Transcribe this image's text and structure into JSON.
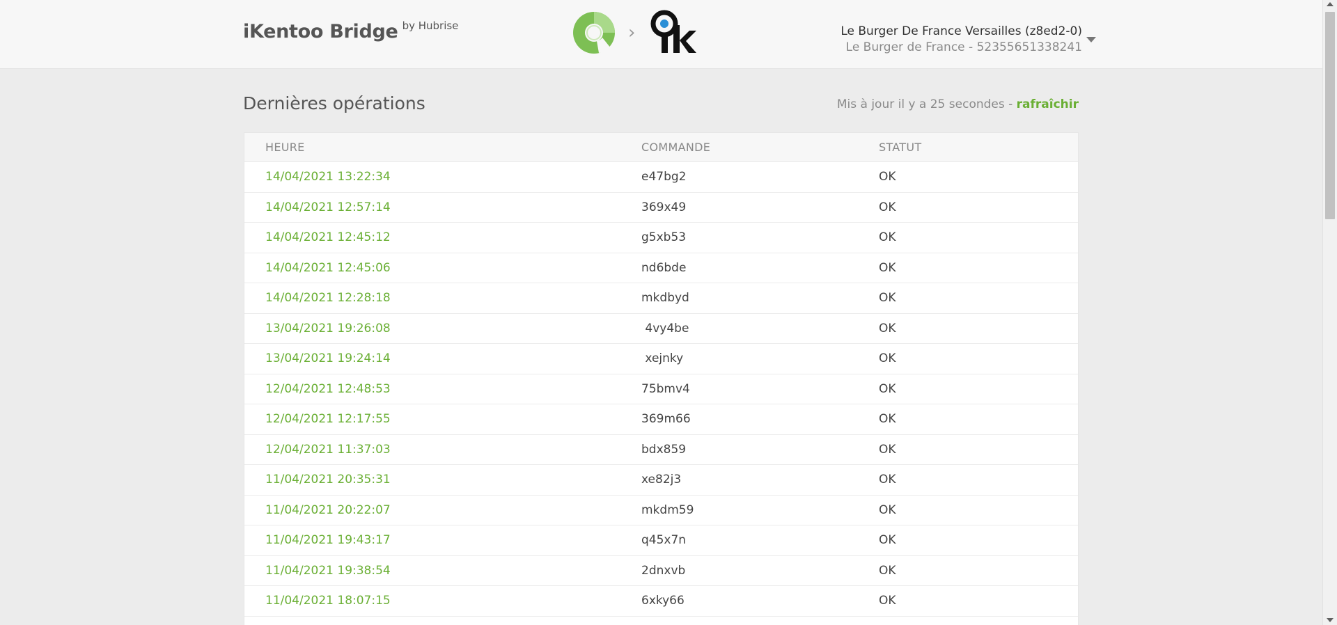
{
  "header": {
    "title": "iKentoo Bridge",
    "by": "by Hubrise",
    "hubrise_logo": "hubrise-logo",
    "ikentoo_logo": "ikentoo-logo",
    "separator": "›",
    "location_name": "Le Burger De France Versailles (z8ed2-0)",
    "location_sub": "Le Burger de France - 52355651338241",
    "dropdown_icon": "caret-down-icon"
  },
  "main": {
    "section_title": "Dernières opérations",
    "update_text": "Mis à jour il y a 25 secondes - ",
    "refresh_label": "rafraîchir"
  },
  "table": {
    "headers": [
      "HEURE",
      "COMMANDE",
      "STATUT"
    ],
    "rows": [
      {
        "time": "14/04/2021 13:22:34",
        "order": "e47bg2",
        "status": "OK"
      },
      {
        "time": "14/04/2021 12:57:14",
        "order": "369x49",
        "status": "OK"
      },
      {
        "time": "14/04/2021 12:45:12",
        "order": "g5xb53",
        "status": "OK"
      },
      {
        "time": "14/04/2021 12:45:06",
        "order": "nd6bde",
        "status": "OK"
      },
      {
        "time": "14/04/2021 12:28:18",
        "order": "mkdbyd",
        "status": "OK"
      },
      {
        "time": "13/04/2021 19:26:08",
        "order": " 4vy4be",
        "status": "OK"
      },
      {
        "time": "13/04/2021 19:24:14",
        "order": " xejnky",
        "status": "OK"
      },
      {
        "time": "12/04/2021 12:48:53",
        "order": "75bmv4",
        "status": "OK"
      },
      {
        "time": "12/04/2021 12:17:55",
        "order": "369m66",
        "status": "OK"
      },
      {
        "time": "12/04/2021 11:37:03",
        "order": "bdx859",
        "status": "OK"
      },
      {
        "time": "11/04/2021 20:35:31",
        "order": "xe82j3",
        "status": "OK"
      },
      {
        "time": "11/04/2021 20:22:07",
        "order": "mkdm59",
        "status": "OK"
      },
      {
        "time": "11/04/2021 19:43:17",
        "order": "q45x7n",
        "status": "OK"
      },
      {
        "time": "11/04/2021 19:38:54",
        "order": "2dnxvb",
        "status": "OK"
      },
      {
        "time": "11/04/2021 18:07:15",
        "order": "6xky66",
        "status": "OK"
      },
      {
        "time": "",
        "order": "",
        "status": ""
      }
    ]
  },
  "colors": {
    "accent": "#6aaf34",
    "background": "#ececec",
    "header_bg": "#f7f7f7"
  }
}
